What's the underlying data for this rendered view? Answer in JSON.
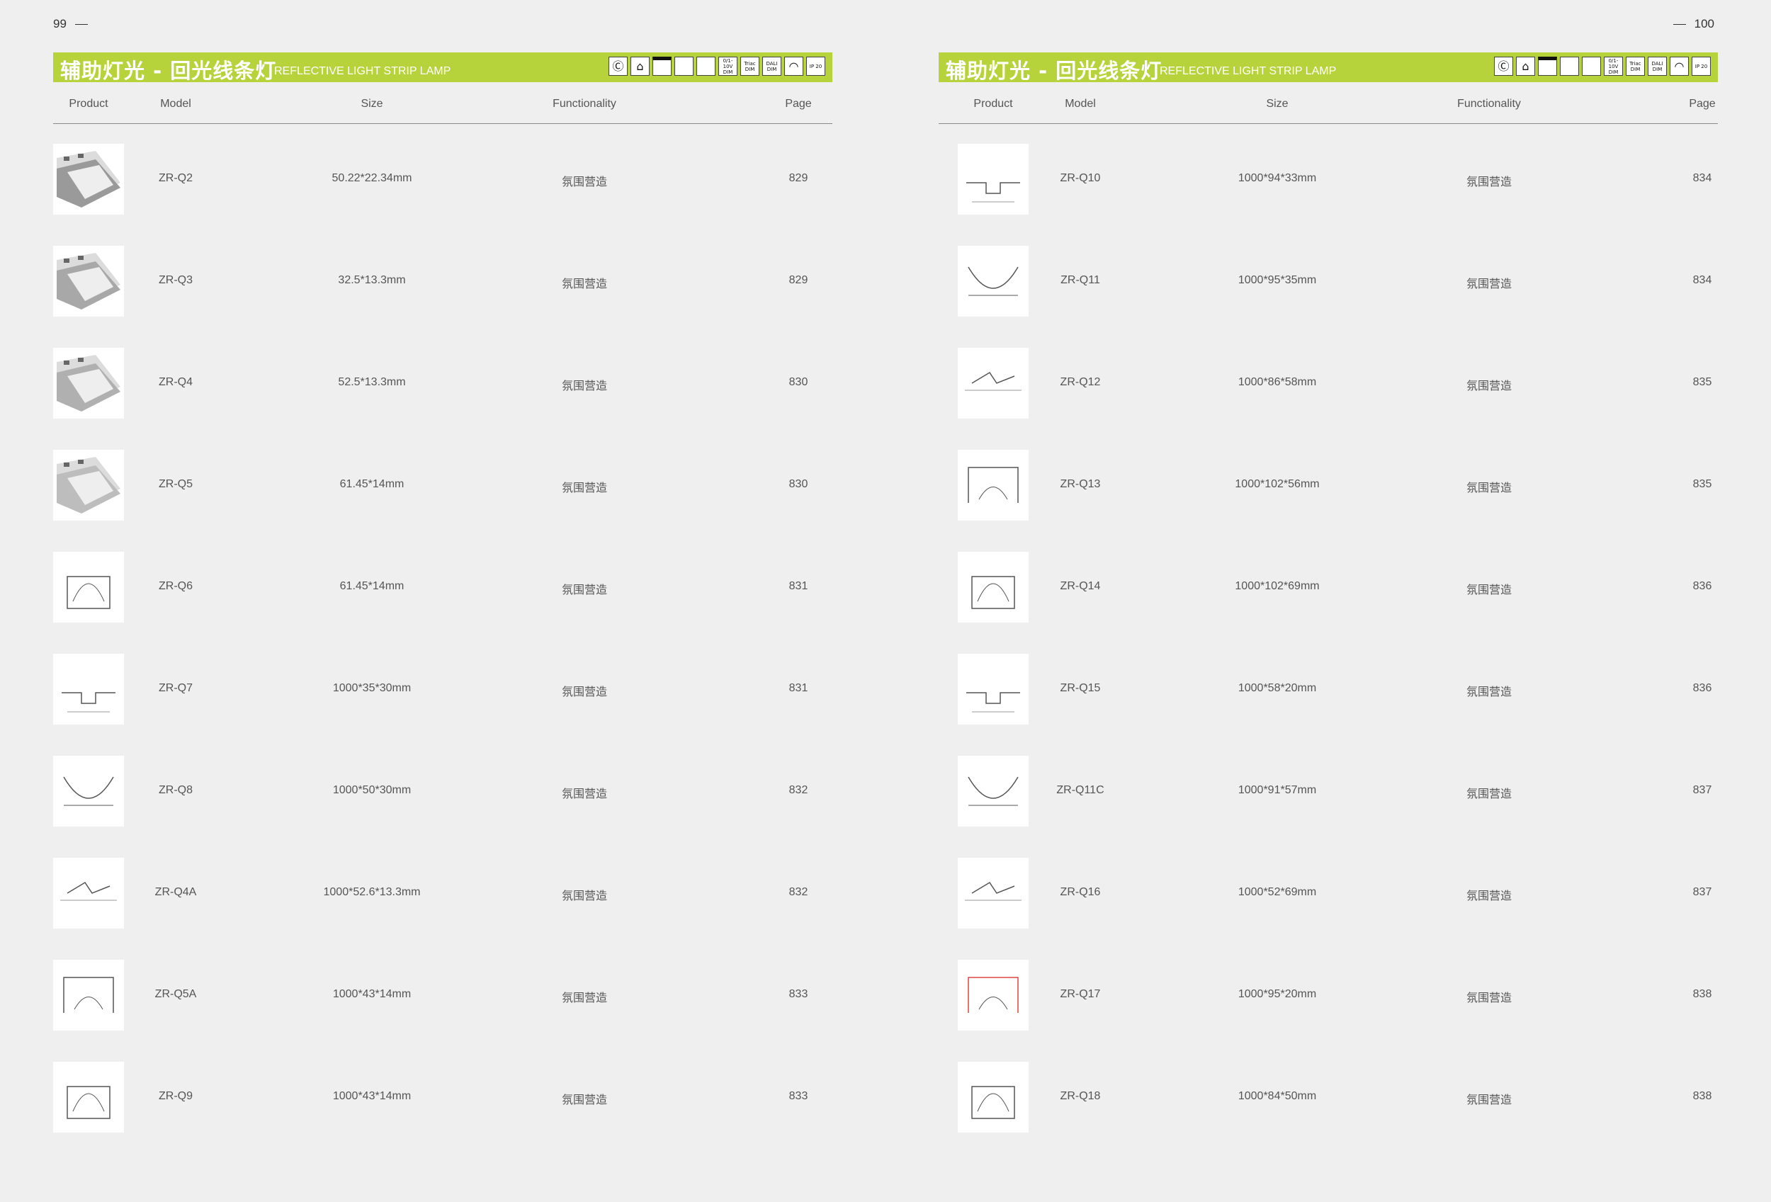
{
  "page_left_number": "99",
  "page_right_number": "100",
  "banner": {
    "title_cn": "辅助灯光 - 回光线条灯",
    "title_en": "REFLECTIVE LIGHT STRIP LAMP",
    "color": "#b7d33b",
    "icons": [
      "ccc-icon",
      "home-icon",
      "black-bar-icon",
      "cri-range-icon",
      "beam-angle-icon",
      "0-1-10v-dim-icon",
      "triac-dim-icon",
      "dali-dim-icon",
      "arc-icon",
      "ip-20-icon"
    ],
    "icon_labels": [
      "Ⓒ",
      "⌂",
      "",
      "",
      "",
      "0/1-10V DIM",
      "Triac DIM",
      "DALI DIM",
      "◠",
      "IP 20"
    ]
  },
  "headers": {
    "product": "Product",
    "model": "Model",
    "size": "Size",
    "functionality": "Functionality",
    "page": "Page"
  },
  "left_rows": [
    {
      "model": "ZR-Q2",
      "size": "50.22*22.34mm",
      "function": "氛围营造",
      "page": "829",
      "thumb": "photo"
    },
    {
      "model": "ZR-Q3",
      "size": "32.5*13.3mm",
      "function": "氛围营造",
      "page": "829",
      "thumb": "photo"
    },
    {
      "model": "ZR-Q4",
      "size": "52.5*13.3mm",
      "function": "氛围营造",
      "page": "830",
      "thumb": "photo"
    },
    {
      "model": "ZR-Q5",
      "size": "61.45*14mm",
      "function": "氛围营造",
      "page": "830",
      "thumb": "photo"
    },
    {
      "model": "ZR-Q6",
      "size": "61.45*14mm",
      "function": "氛围营造",
      "page": "831",
      "thumb": "drawing"
    },
    {
      "model": "ZR-Q7",
      "size": "1000*35*30mm",
      "function": "氛围营造",
      "page": "831",
      "thumb": "drawing"
    },
    {
      "model": "ZR-Q8",
      "size": "1000*50*30mm",
      "function": "氛围营造",
      "page": "832",
      "thumb": "drawing"
    },
    {
      "model": "ZR-Q4A",
      "size": "1000*52.6*13.3mm",
      "function": "氛围营造",
      "page": "832",
      "thumb": "drawing"
    },
    {
      "model": "ZR-Q5A",
      "size": "1000*43*14mm",
      "function": "氛围营造",
      "page": "833",
      "thumb": "drawing"
    },
    {
      "model": "ZR-Q9",
      "size": "1000*43*14mm",
      "function": "氛围营造",
      "page": "833",
      "thumb": "drawing"
    }
  ],
  "right_rows": [
    {
      "model": "ZR-Q10",
      "size": "1000*94*33mm",
      "function": "氛围营造",
      "page": "834",
      "thumb": "drawing"
    },
    {
      "model": "ZR-Q11",
      "size": "1000*95*35mm",
      "function": "氛围营造",
      "page": "834",
      "thumb": "drawing"
    },
    {
      "model": "ZR-Q12",
      "size": "1000*86*58mm",
      "function": "氛围营造",
      "page": "835",
      "thumb": "drawing"
    },
    {
      "model": "ZR-Q13",
      "size": "1000*102*56mm",
      "function": "氛围营造",
      "page": "835",
      "thumb": "drawing"
    },
    {
      "model": "ZR-Q14",
      "size": "1000*102*69mm",
      "function": "氛围营造",
      "page": "836",
      "thumb": "drawing"
    },
    {
      "model": "ZR-Q15",
      "size": "1000*58*20mm",
      "function": "氛围营造",
      "page": "836",
      "thumb": "drawing"
    },
    {
      "model": "ZR-Q11C",
      "size": "1000*91*57mm",
      "function": "氛围营造",
      "page": "837",
      "thumb": "drawing"
    },
    {
      "model": "ZR-Q16",
      "size": "1000*52*69mm",
      "function": "氛围营造",
      "page": "837",
      "thumb": "drawing"
    },
    {
      "model": "ZR-Q17",
      "size": "1000*95*20mm",
      "function": "氛围营造",
      "page": "838",
      "thumb": "drawing"
    },
    {
      "model": "ZR-Q18",
      "size": "1000*84*50mm",
      "function": "氛围营造",
      "page": "838",
      "thumb": "drawing"
    }
  ]
}
